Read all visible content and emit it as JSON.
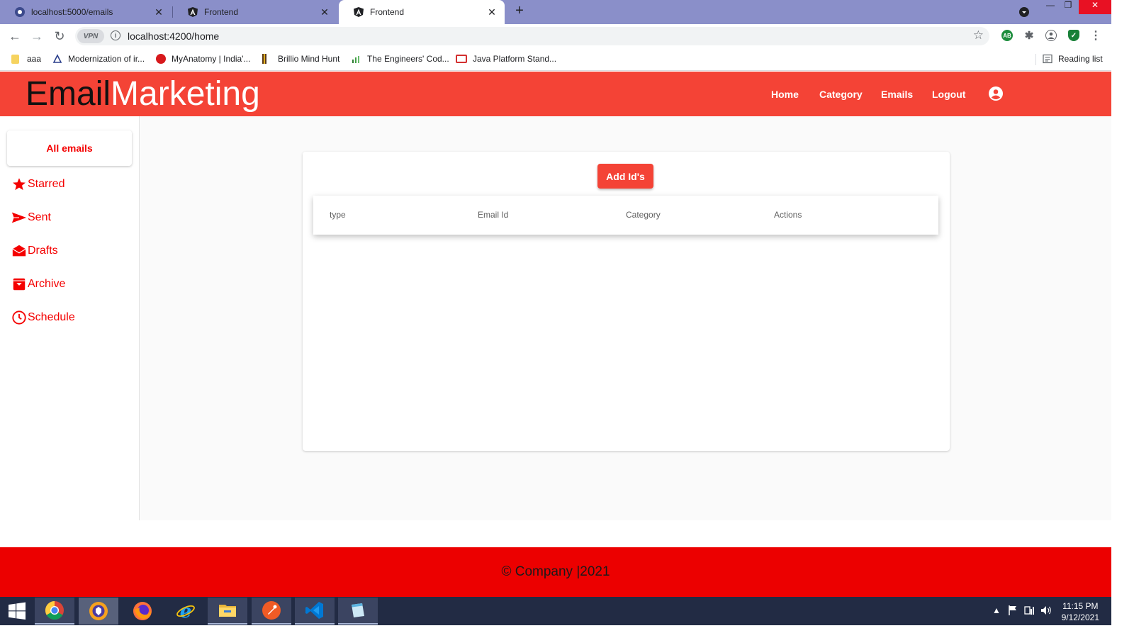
{
  "browser": {
    "tabs": [
      {
        "title": "localhost:5000/emails",
        "icon": "globe-icon",
        "active": false
      },
      {
        "title": "Frontend",
        "icon": "angular-icon",
        "active": false
      },
      {
        "title": "Frontend",
        "icon": "angular-icon",
        "active": true
      }
    ],
    "vpn_label": "VPN",
    "url": "localhost:4200/home",
    "bookmarks": [
      {
        "label": "aaa",
        "icon": "folder-icon"
      },
      {
        "label": "Modernization of ir...",
        "icon": "bookmark-icon"
      },
      {
        "label": "MyAnatomy | India'...",
        "icon": "myanatomy-icon"
      },
      {
        "label": "Brillio Mind Hunt",
        "icon": "brillio-icon"
      },
      {
        "label": "The Engineers' Cod...",
        "icon": "chart-icon"
      },
      {
        "label": "Java Platform Stand...",
        "icon": "oracle-icon"
      }
    ],
    "reading_list": "Reading list"
  },
  "header": {
    "brand_part1": "Email",
    "brand_part2": "Marketing",
    "nav": [
      "Home",
      "Category",
      "Emails",
      "Logout"
    ]
  },
  "sidebar": {
    "primary": "All emails",
    "items": [
      "Starred",
      "Sent",
      "Drafts",
      "Archive",
      "Schedule"
    ]
  },
  "main": {
    "add_button": "Add Id's",
    "columns": [
      "type",
      "Email Id",
      "Category",
      "Actions"
    ]
  },
  "footer": {
    "text": "© Company |2021"
  },
  "taskbar": {
    "time": "11:15 PM",
    "date": "9/12/2021"
  },
  "colors": {
    "header": "#f44336",
    "footer": "#ec0000",
    "sidebar_text": "#f40000"
  }
}
